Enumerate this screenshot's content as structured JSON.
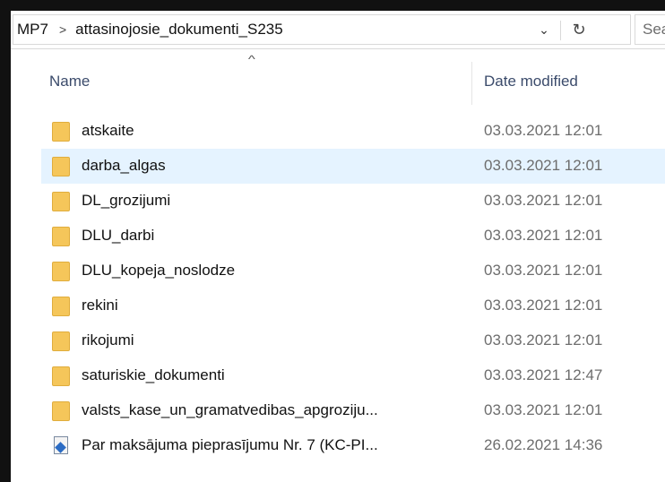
{
  "address": {
    "crumbs": [
      "MP7",
      "attasinojosie_dokumenti_S235"
    ],
    "separator": ">",
    "dropdown_glyph": "⌄",
    "refresh_glyph": "↻"
  },
  "search": {
    "placeholder": "Sea"
  },
  "columns": {
    "name": "Name",
    "date_modified": "Date modified",
    "sort_glyph": "^"
  },
  "files": [
    {
      "name": "atskaite",
      "date": "03.03.2021 12:01",
      "icon": "folder-icon"
    },
    {
      "name": "darba_algas",
      "date": "03.03.2021 12:01",
      "icon": "folder-icon",
      "selected": true
    },
    {
      "name": "DL_grozijumi",
      "date": "03.03.2021 12:01",
      "icon": "folder-icon"
    },
    {
      "name": "DLU_darbi",
      "date": "03.03.2021 12:01",
      "icon": "folder-icon"
    },
    {
      "name": "DLU_kopeja_noslodze",
      "date": "03.03.2021 12:01",
      "icon": "folder-icon"
    },
    {
      "name": "rekini",
      "date": "03.03.2021 12:01",
      "icon": "folder-icon"
    },
    {
      "name": "rikojumi",
      "date": "03.03.2021 12:01",
      "icon": "folder-icon"
    },
    {
      "name": "saturiskie_dokumenti",
      "date": "03.03.2021 12:47",
      "icon": "folder-icon"
    },
    {
      "name": "valsts_kase_un_gramatvedibas_apgroziju...",
      "date": "03.03.2021 12:01",
      "icon": "folder-icon"
    },
    {
      "name": "Par maksājuma pieprasījumu Nr. 7 (KC-PI...",
      "date": "26.02.2021 14:36",
      "icon": "document-icon"
    }
  ],
  "colors": {
    "selection": "#e5f3ff",
    "folder": "#f5c65a",
    "header_text": "#3b4b6b",
    "date_text": "#6d6d6d"
  }
}
